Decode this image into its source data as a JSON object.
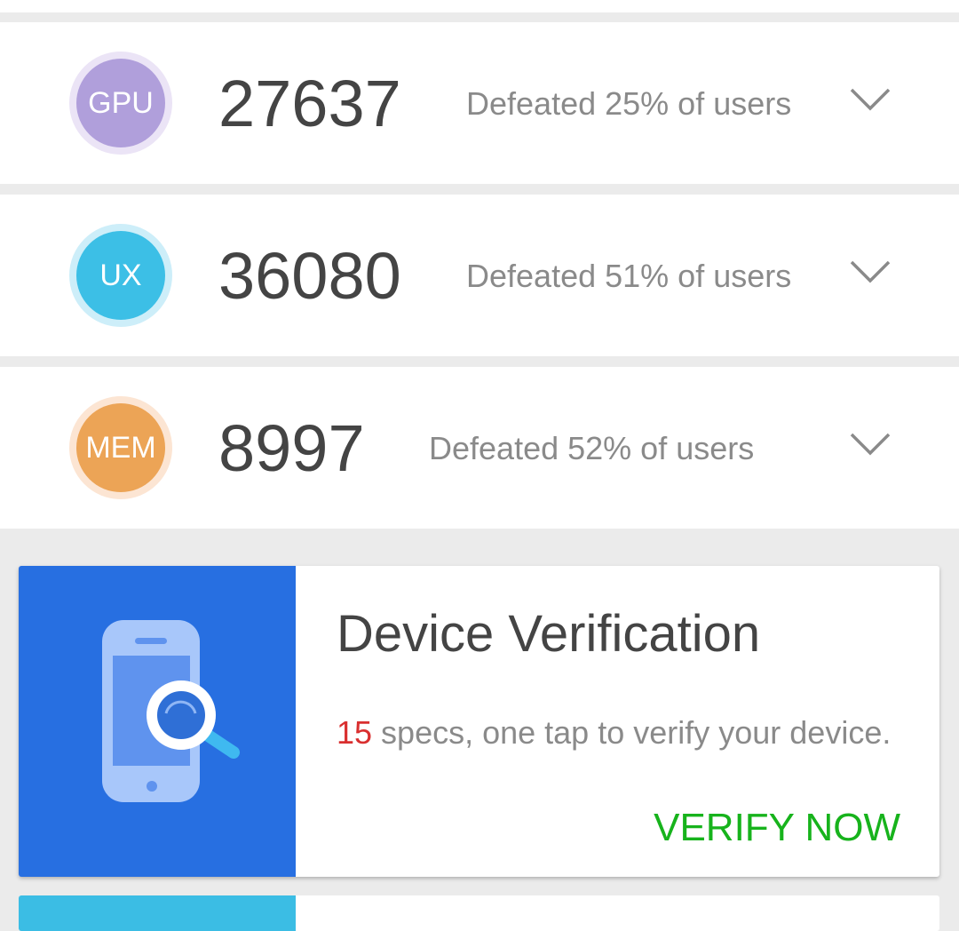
{
  "scores": [
    {
      "key": "gpu",
      "badge": "GPU",
      "score": "27637",
      "defeated": "Defeated 25% of users",
      "color": "#b09fdb",
      "ring": "#ebe4f6",
      "chevron_icon": "chevron-down-icon"
    },
    {
      "key": "ux",
      "badge": "UX",
      "score": "36080",
      "defeated": "Defeated 51% of users",
      "color": "#3cbfe6",
      "ring": "#cdeef9",
      "chevron_icon": "chevron-down-icon"
    },
    {
      "key": "mem",
      "badge": "MEM",
      "score": "8997",
      "defeated": "Defeated 52% of users",
      "color": "#eca456",
      "ring": "#fce5d3",
      "chevron_icon": "chevron-down-icon"
    }
  ],
  "verification_card": {
    "title": "Device Verification",
    "spec_count": "15",
    "description": " specs, one tap to verify your device.",
    "cta": "VERIFY NOW",
    "icon": "phone-search-icon",
    "colors": {
      "art_bg": "#276fe1",
      "cta": "#17b31c",
      "count": "#d92f2f"
    }
  },
  "next_card": {
    "colors": {
      "art_bg": "#3bbde4"
    }
  }
}
